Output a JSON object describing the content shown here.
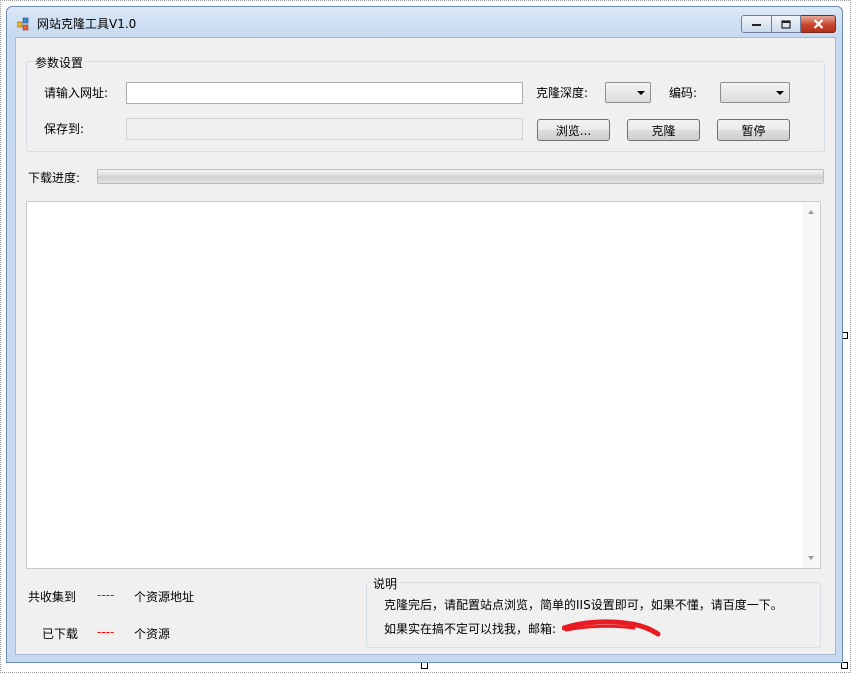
{
  "window": {
    "title": "网站克隆工具V1.0"
  },
  "params": {
    "group_title": "参数设置",
    "url_label": "请输入网址:",
    "url_value": "",
    "depth_label": "克隆深度:",
    "depth_value": "",
    "encoding_label": "编码:",
    "encoding_value": "",
    "save_label": "保存到:",
    "save_value": "",
    "browse_button": "浏览...",
    "clone_button": "克隆",
    "pause_button": "暂停"
  },
  "progress": {
    "label": "下载进度:",
    "value": 0
  },
  "log": {
    "text": ""
  },
  "stats": {
    "collected_label": "共收集到",
    "collected_value": "----",
    "collected_suffix": "个资源地址",
    "downloaded_label": "已下载",
    "downloaded_value": "----",
    "downloaded_suffix": "个资源"
  },
  "notes": {
    "group_title": "说明",
    "line1": "克隆完后，请配置站点浏览，简单的IIS设置即可，如果不懂，请百度一下。",
    "line2": "如果实在搞不定可以找我，邮箱:"
  },
  "colors": {
    "accent_red": "#ff0000",
    "progress_fill": "#06b025"
  }
}
